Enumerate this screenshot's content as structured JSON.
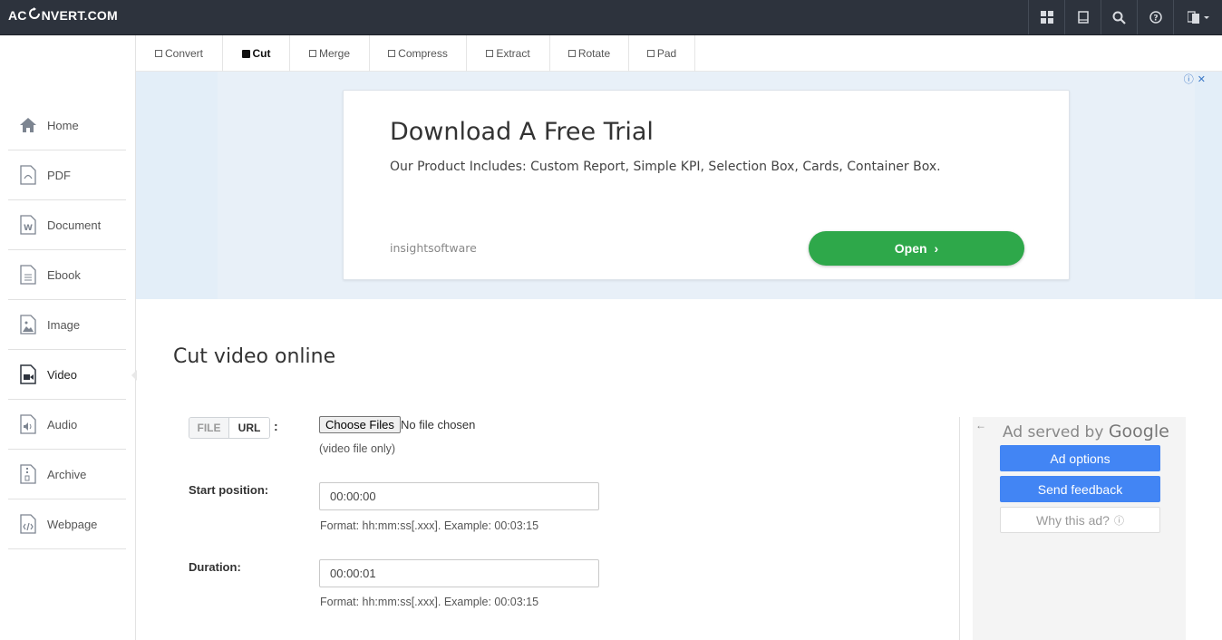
{
  "header": {
    "logo_prefix": "AC",
    "logo_suffix": "NVERT.COM",
    "icons": [
      "grid-icon",
      "bookmark-icon",
      "search-icon",
      "help-icon",
      "language-icon"
    ]
  },
  "sidebar": {
    "items": [
      {
        "label": "Home",
        "icon": "home-icon"
      },
      {
        "label": "PDF",
        "icon": "pdf-icon"
      },
      {
        "label": "Document",
        "icon": "document-icon"
      },
      {
        "label": "Ebook",
        "icon": "ebook-icon"
      },
      {
        "label": "Image",
        "icon": "image-icon"
      },
      {
        "label": "Video",
        "icon": "video-icon"
      },
      {
        "label": "Audio",
        "icon": "audio-icon"
      },
      {
        "label": "Archive",
        "icon": "archive-icon"
      },
      {
        "label": "Webpage",
        "icon": "webpage-icon"
      }
    ],
    "active": "Video"
  },
  "tabs": [
    {
      "label": "Convert"
    },
    {
      "label": "Cut"
    },
    {
      "label": "Merge"
    },
    {
      "label": "Compress"
    },
    {
      "label": "Extract"
    },
    {
      "label": "Rotate"
    },
    {
      "label": "Pad"
    }
  ],
  "active_tab": "Cut",
  "banner_ad": {
    "title": "Download A Free Trial",
    "description": "Our Product Includes: Custom Report, Simple KPI, Selection Box, Cards, Container Box.",
    "brand": "insightsoftware",
    "cta": "Open",
    "cta_color": "#2ea84a"
  },
  "main": {
    "title": "Cut video online",
    "source": {
      "file_label": "FILE",
      "url_label": "URL",
      "colon": ":",
      "choose_button": "Choose Files",
      "no_file": "No file chosen",
      "hint": "(video file only)"
    },
    "start": {
      "label": "Start position:",
      "value": "00:00:00",
      "hint": "Format: hh:mm:ss[.xxx]. Example: 00:03:15"
    },
    "duration": {
      "label": "Duration:",
      "value": "00:00:01",
      "hint": "Format: hh:mm:ss[.xxx]. Example: 00:03:15"
    }
  },
  "side_ad": {
    "served_by": "Ad served by",
    "google": "Google",
    "ad_options": "Ad options",
    "send_feedback": "Send feedback",
    "why_this_ad": "Why this ad?",
    "button_color": "#4285f4"
  },
  "colors": {
    "topbar": "#2d333d",
    "ad_background": "#e3eef8"
  }
}
